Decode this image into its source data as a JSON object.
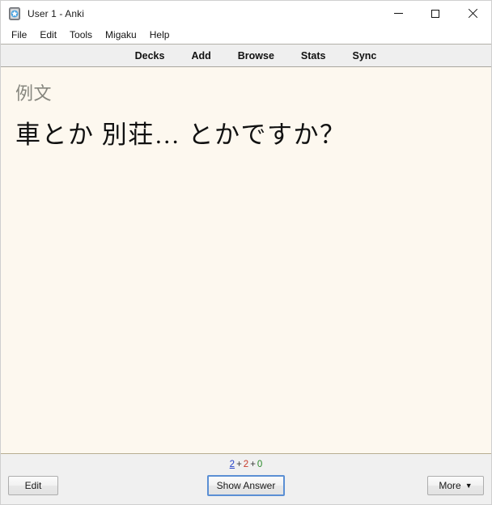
{
  "window": {
    "title": "User 1 - Anki",
    "icon": "anki-app-icon",
    "controls": {
      "minimize": "minimize-icon",
      "maximize": "maximize-icon",
      "close": "close-icon"
    }
  },
  "menubar": {
    "items": [
      {
        "label": "File"
      },
      {
        "label": "Edit"
      },
      {
        "label": "Tools"
      },
      {
        "label": "Migaku"
      },
      {
        "label": "Help"
      }
    ]
  },
  "toolbar": {
    "items": [
      {
        "label": "Decks"
      },
      {
        "label": "Add"
      },
      {
        "label": "Browse"
      },
      {
        "label": "Stats"
      },
      {
        "label": "Sync"
      }
    ]
  },
  "card": {
    "field_label": "例文",
    "sentence": "車とか 別荘… とかですか？",
    "background_color": "#fdf8ef"
  },
  "bottom": {
    "counts": {
      "new": "2",
      "learning": "2",
      "due": "0",
      "separator": "+",
      "new_color": "#2340c8",
      "learning_color": "#c83a2a",
      "due_color": "#2a8a2a"
    },
    "edit_button": "Edit",
    "show_answer_button": "Show Answer",
    "more_button": "More",
    "more_caret": "▼"
  }
}
